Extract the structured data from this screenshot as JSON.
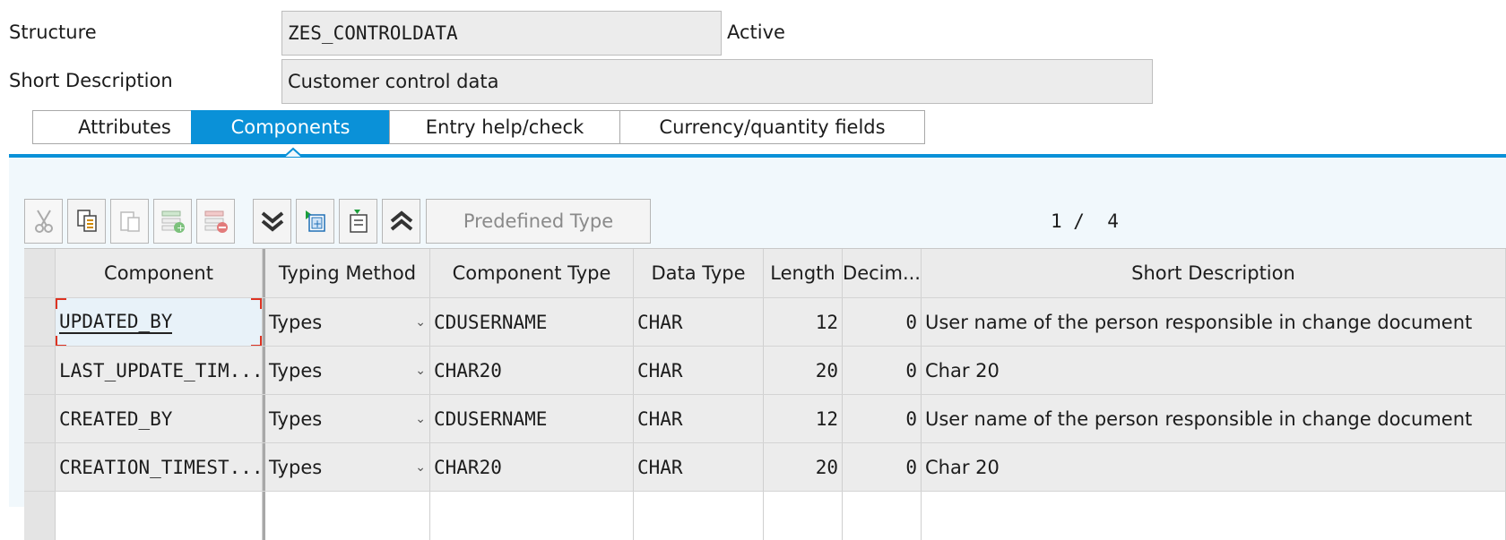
{
  "header": {
    "structure_label": "Structure",
    "structure_value": "ZES_CONTROLDATA",
    "status": "Active",
    "short_desc_label": "Short Description",
    "short_desc_value": "Customer control data"
  },
  "tabs": [
    {
      "label": "Attributes",
      "active": false
    },
    {
      "label": "Components",
      "active": true
    },
    {
      "label": "Entry help/check",
      "active": false
    },
    {
      "label": "Currency/quantity fields",
      "active": false
    }
  ],
  "toolbar": {
    "predefined_type_label": "Predefined Type",
    "pager": "1 /  4"
  },
  "table": {
    "columns": [
      "Component",
      "Typing Method",
      "Component Type",
      "Data Type",
      "Length",
      "Decim...",
      "Short Description"
    ],
    "rows": [
      {
        "component": "UPDATED_BY",
        "typing": "Types",
        "comp_type": "CDUSERNAME",
        "data_type": "CHAR",
        "length": "12",
        "decimals": "0",
        "desc": "User name of the person responsible in change document"
      },
      {
        "component": "LAST_UPDATE_TIM...",
        "typing": "Types",
        "comp_type": "CHAR20",
        "data_type": "CHAR",
        "length": "20",
        "decimals": "0",
        "desc": "Char 20"
      },
      {
        "component": "CREATED_BY",
        "typing": "Types",
        "comp_type": "CDUSERNAME",
        "data_type": "CHAR",
        "length": "12",
        "decimals": "0",
        "desc": "User name of the person responsible in change document"
      },
      {
        "component": "CREATION_TIMEST...",
        "typing": "Types",
        "comp_type": "CHAR20",
        "data_type": "CHAR",
        "length": "20",
        "decimals": "0",
        "desc": "Char 20"
      }
    ]
  },
  "colors": {
    "accent": "#0a91d8"
  }
}
